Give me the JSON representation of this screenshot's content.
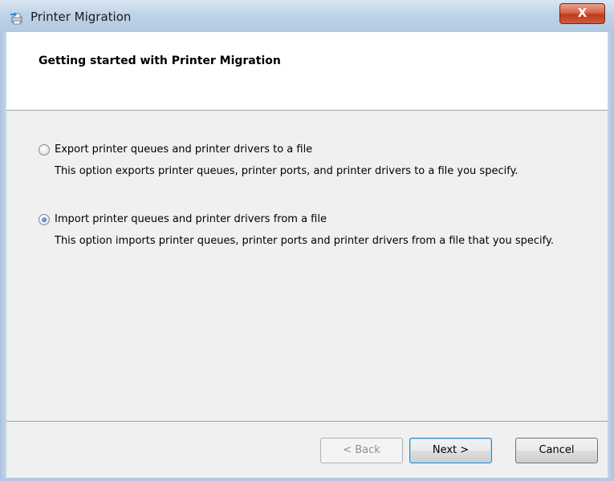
{
  "window": {
    "title": "Printer Migration",
    "close_label": "X"
  },
  "header": {
    "title": "Getting started with Printer Migration"
  },
  "options": [
    {
      "label": "Export printer queues and printer drivers to a file",
      "description": "This option exports printer queues, printer ports, and printer drivers to a file you specify.",
      "selected": false
    },
    {
      "label": "Import printer queues and printer drivers from a file",
      "description": "This option imports printer queues, printer ports and printer drivers from a file that you specify.",
      "selected": true
    }
  ],
  "buttons": {
    "back": "< Back",
    "next": "Next >",
    "cancel": "Cancel"
  },
  "icons": {
    "app": "printer-migration-icon",
    "close": "close-icon"
  }
}
